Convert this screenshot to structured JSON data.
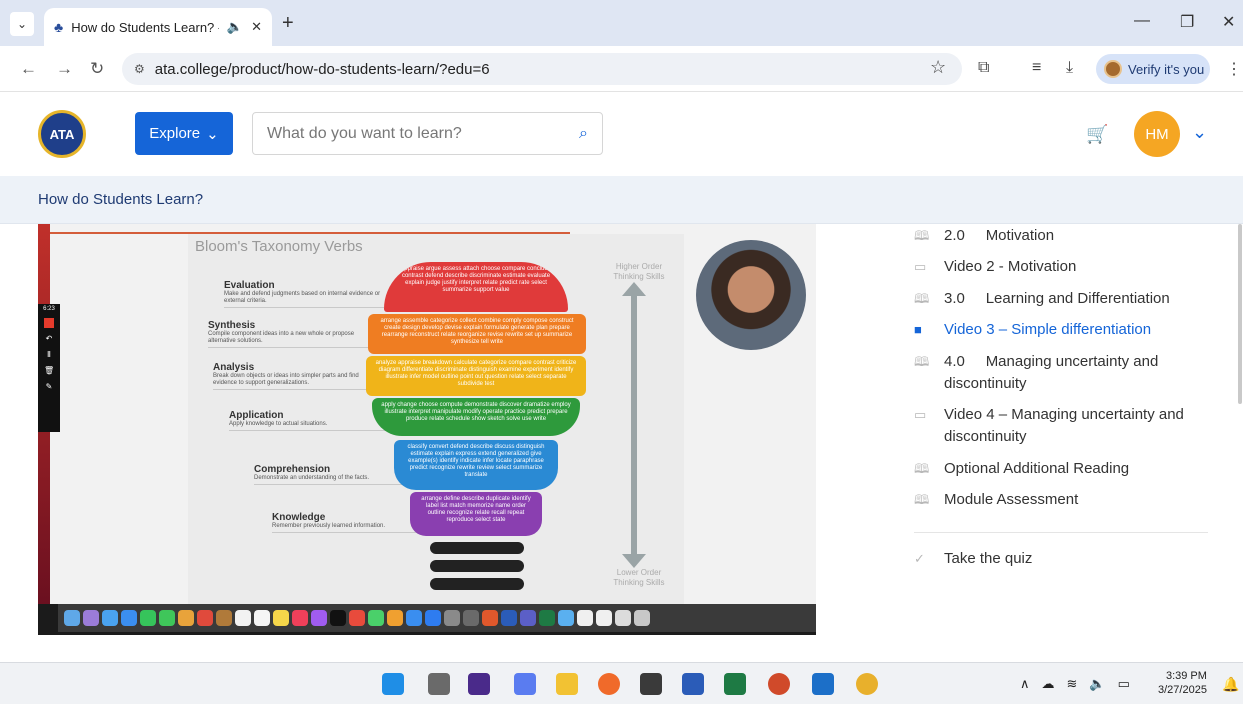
{
  "browser": {
    "tab_title": "How do Students Learn? - ∕",
    "url": "ata.college/product/how-do-students-learn/?edu=6",
    "verify_label": "Verify it's you"
  },
  "header": {
    "logo_text": "ATA",
    "explore_label": "Explore",
    "search_placeholder": "What do you want to learn?",
    "avatar_initials": "HM"
  },
  "course": {
    "title": "How do Students Learn?"
  },
  "slide": {
    "title": "Bloom's Taxonomy Verbs",
    "higher_label": "Higher Order Thinking Skills",
    "lower_label": "Lower Order Thinking Skills",
    "recording_time": "6:23",
    "levels": [
      {
        "name": "Evaluation",
        "desc": "Make and defend judgments based on internal evidence or external criteria."
      },
      {
        "name": "Synthesis",
        "desc": "Compile component ideas into a new whole or propose alternative solutions."
      },
      {
        "name": "Analysis",
        "desc": "Break down objects or ideas into simpler parts and find evidence to support generalizations."
      },
      {
        "name": "Application",
        "desc": "Apply knowledge to actual situations."
      },
      {
        "name": "Comprehension",
        "desc": "Demonstrate an understanding of the facts."
      },
      {
        "name": "Knowledge",
        "desc": "Remember previously learned information."
      }
    ],
    "verbs": [
      "appraise argue assess attach choose compare conclude contrast defend describe discriminate estimate evaluate explain judge justify interpret relate predict rate select summarize support value",
      "arrange assemble categorize collect combine comply compose construct create design develop devise explain formulate generate plan prepare rearrange reconstruct relate reorganize revise rewrite set up summarize synthesize tell write",
      "analyze appraise breakdown calculate categorize compare contrast criticize diagram differentiate discriminate distinguish examine experiment identify illustrate infer model outline point out question relate select separate subdivide test",
      "apply change choose compute demonstrate discover dramatize employ illustrate interpret manipulate modify operate practice predict prepare produce relate schedule show sketch solve use write",
      "classify convert defend describe discuss distinguish estimate explain express extend generalized give example(s) identify indicate infer locate paraphrase predict recognize rewrite review select summarize translate",
      "arrange define describe duplicate identify label list match memorize name order outline recognize relate recall repeat reproduce select state"
    ],
    "colors": [
      "#e03a3a",
      "#ef7d22",
      "#f0b419",
      "#2e9a3c",
      "#2a8ad4",
      "#8a3fb0"
    ]
  },
  "curriculum": [
    {
      "icon": "book-icon",
      "label": "2.0     Motivation",
      "active": false
    },
    {
      "icon": "video-icon",
      "label": "Video 2 - Motivation",
      "active": false
    },
    {
      "icon": "book-icon",
      "label": "3.0     Learning and Differentiation",
      "active": false
    },
    {
      "icon": "video-icon",
      "label": "Video 3 – Simple differentiation",
      "active": true
    },
    {
      "icon": "book-icon",
      "label": "4.0     Managing uncertainty and discontinuity",
      "active": false
    },
    {
      "icon": "video-icon",
      "label": "Video 4 – Managing uncertainty and discontinuity",
      "active": false
    },
    {
      "icon": "book-icon",
      "label": "Optional Additional Reading",
      "active": false
    },
    {
      "icon": "book-icon",
      "label": "Module Assessment",
      "active": false
    },
    {
      "icon": "quiz-icon",
      "label": "Take the quiz",
      "active": false
    }
  ],
  "taskbar": {
    "time": "3:39 PM",
    "date": "3/27/2025"
  }
}
